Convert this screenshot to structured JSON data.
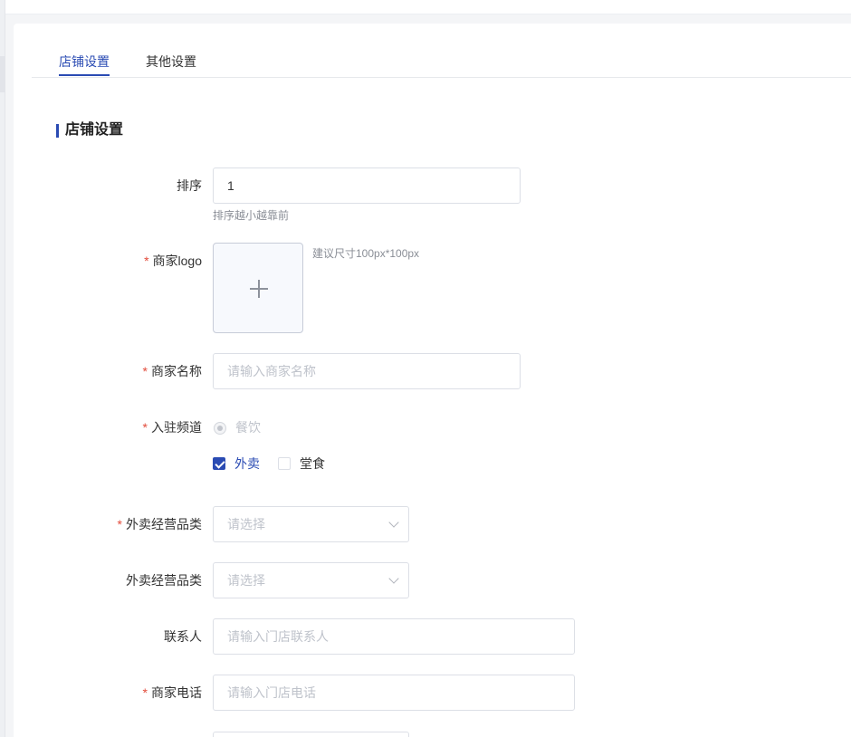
{
  "tabs": [
    "店铺设置",
    "其他设置"
  ],
  "active_tab": 0,
  "section_title": "店铺设置",
  "form": {
    "sort": {
      "label": "排序",
      "value": "1",
      "hint": "排序越小越靠前"
    },
    "logo": {
      "label": "商家logo",
      "required": "*",
      "hint": "建议尺寸100px*100px"
    },
    "name": {
      "label": "商家名称",
      "required": "*",
      "placeholder": "请输入商家名称"
    },
    "channel": {
      "label": "入驻频道",
      "required": "*",
      "radio_label": "餐饮",
      "checkboxes": [
        {
          "label": "外卖",
          "checked": true
        },
        {
          "label": "堂食",
          "checked": false
        }
      ]
    },
    "takeout_category_required": {
      "label": "外卖经营品类",
      "required": "*",
      "placeholder": "请选择"
    },
    "takeout_category": {
      "label": "外卖经营品类",
      "placeholder": "请选择"
    },
    "contact": {
      "label": "联系人",
      "placeholder": "请输入门店联系人"
    },
    "phone": {
      "label": "商家电话",
      "required": "*",
      "placeholder": "请输入门店电话"
    }
  },
  "colors": {
    "accent": "#2a4bb3",
    "required": "#e24b3b",
    "placeholder": "#bfc3cb"
  },
  "icons": [
    "plus-icon",
    "chevron-down-icon",
    "check-icon"
  ]
}
